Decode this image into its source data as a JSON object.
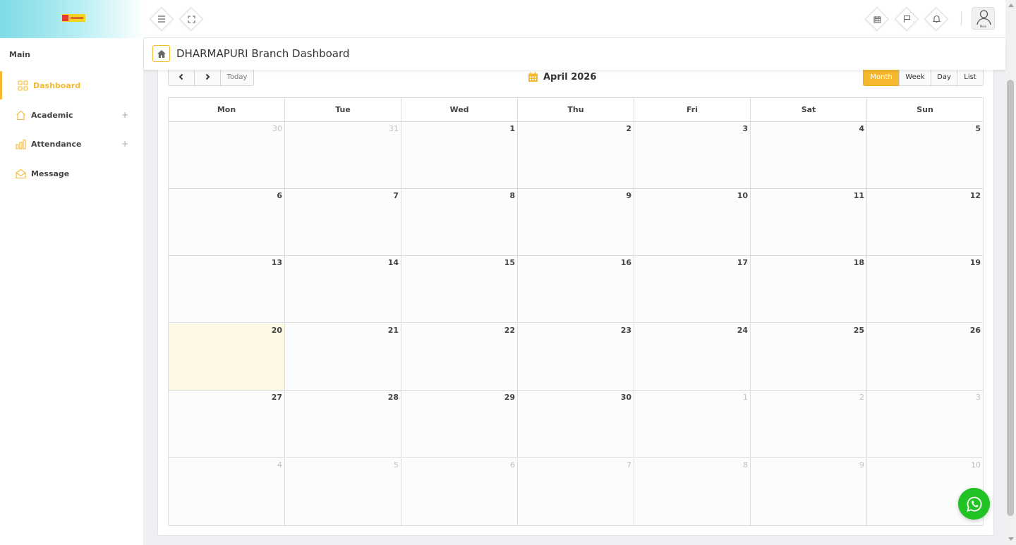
{
  "page_title": "DHARMAPURI Branch Dashboard",
  "sidebar": {
    "heading": "Main",
    "items": [
      {
        "label": "Dashboard",
        "icon": "grid-icon",
        "active": true
      },
      {
        "label": "Academic",
        "icon": "home-icon",
        "expandable": true
      },
      {
        "label": "Attendance",
        "icon": "bar-chart-icon",
        "expandable": true
      },
      {
        "label": "Message",
        "icon": "envelope-open-icon"
      }
    ]
  },
  "topbar": {
    "icons": [
      "menu-icon",
      "fullscreen-icon",
      "calendar-icon",
      "flag-icon",
      "bell-icon"
    ],
    "avatar_label": "Main"
  },
  "calendar": {
    "title": "April 2026",
    "today_label": "Today",
    "views": [
      "Month",
      "Week",
      "Day",
      "List"
    ],
    "active_view": "Month",
    "days_of_week": [
      "Mon",
      "Tue",
      "Wed",
      "Thu",
      "Fri",
      "Sat",
      "Sun"
    ],
    "weeks": [
      [
        "30",
        "31",
        "1",
        "2",
        "3",
        "4",
        "5"
      ],
      [
        "6",
        "7",
        "8",
        "9",
        "10",
        "11",
        "12"
      ],
      [
        "13",
        "14",
        "15",
        "16",
        "17",
        "18",
        "19"
      ],
      [
        "20",
        "21",
        "22",
        "23",
        "24",
        "25",
        "26"
      ],
      [
        "27",
        "28",
        "29",
        "30",
        "1",
        "2",
        "3"
      ],
      [
        "4",
        "5",
        "6",
        "7",
        "8",
        "9",
        "10"
      ]
    ],
    "today": "20"
  },
  "colors": {
    "accent": "#f5b82e",
    "today_bg": "#fcf8e3",
    "whatsapp": "#21c223"
  }
}
